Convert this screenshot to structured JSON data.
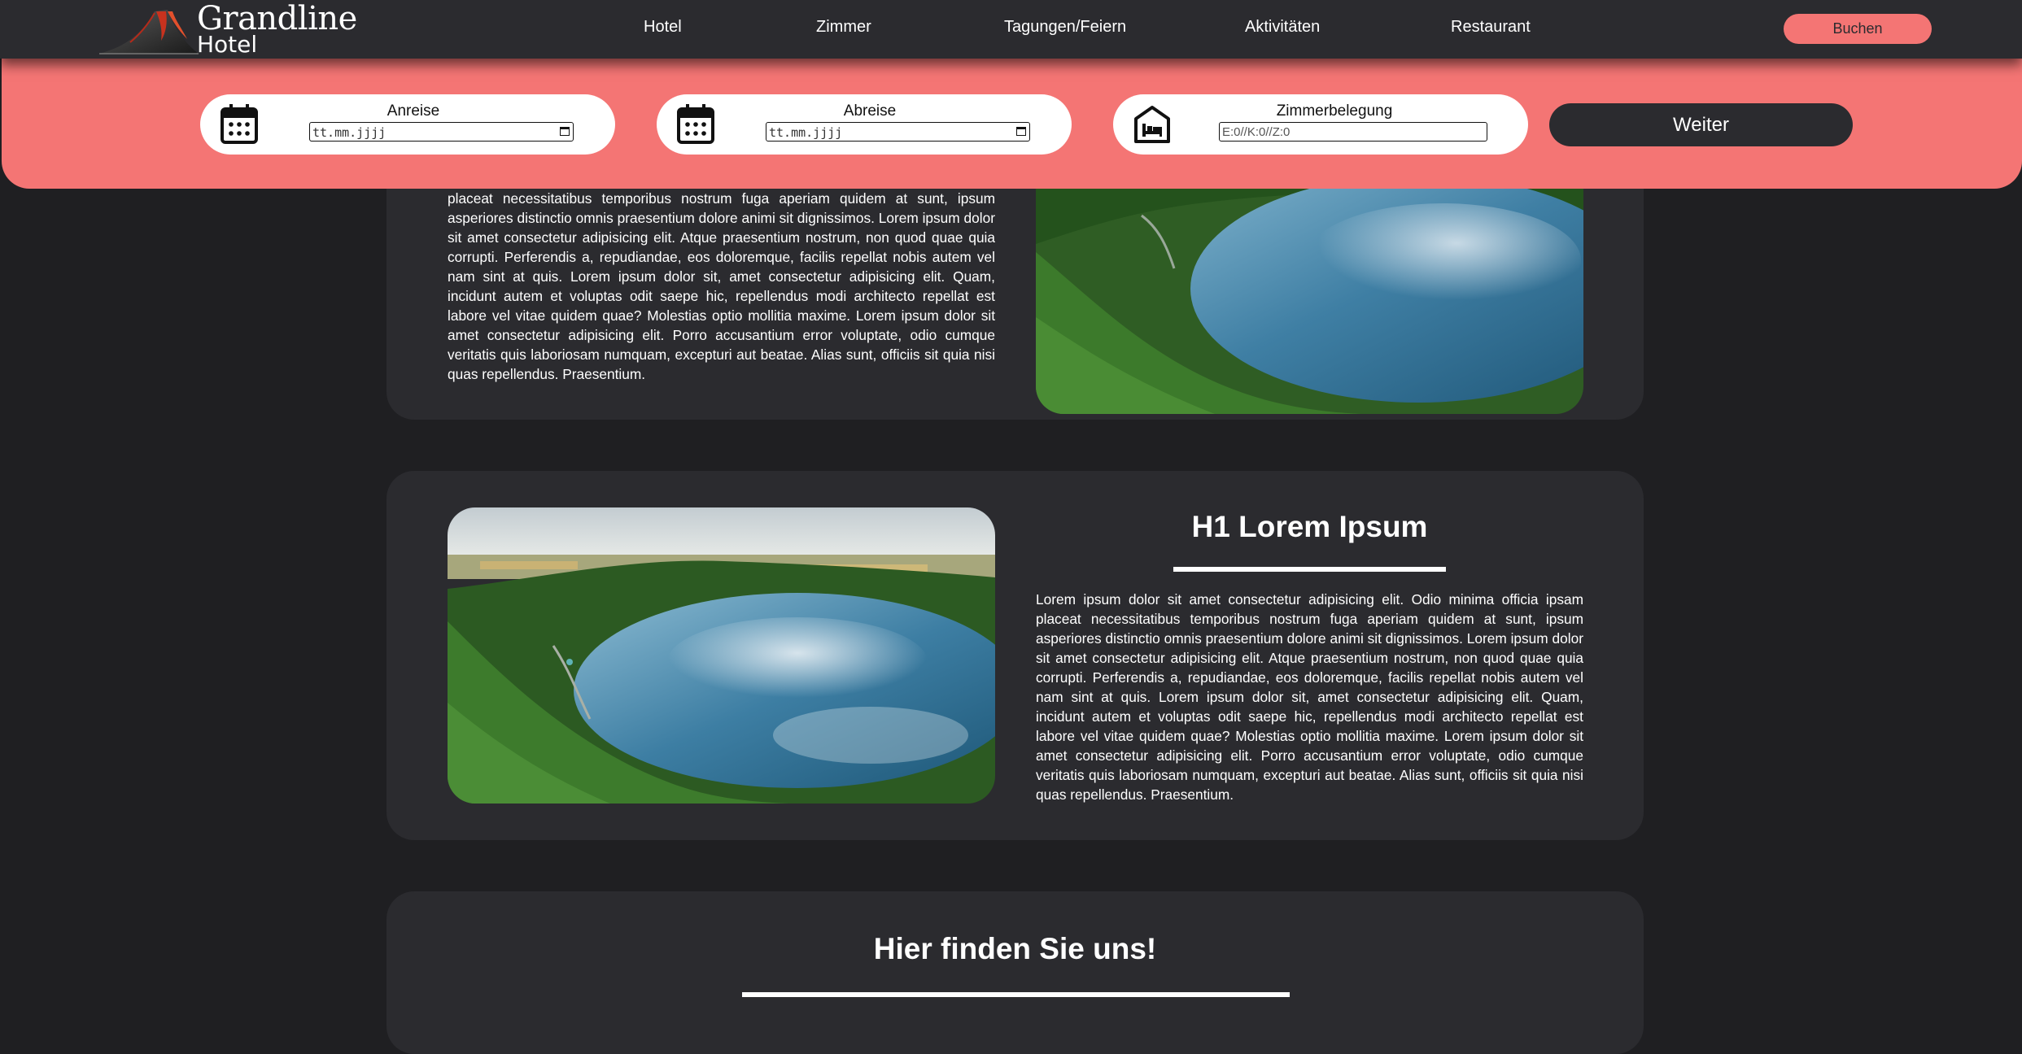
{
  "brand": {
    "name": "Grandline",
    "sub": "Hotel"
  },
  "nav": {
    "items": [
      {
        "label": "Hotel"
      },
      {
        "label": "Zimmer"
      },
      {
        "label": "Tagungen/Feiern"
      },
      {
        "label": "Aktivitäten"
      },
      {
        "label": "Restaurant"
      }
    ],
    "book_label": "Buchen"
  },
  "booking": {
    "arrival": {
      "label": "Anreise",
      "placeholder": "tt.mm.jjjj",
      "icon": "calendar-icon"
    },
    "departure": {
      "label": "Abreise",
      "placeholder": "tt.mm.jjjj",
      "icon": "calendar-icon"
    },
    "rooms": {
      "label": "Zimmerbelegung",
      "value": "E:0//K:0//Z:0",
      "icon": "bed-icon"
    },
    "next_label": "Weiter"
  },
  "sections": [
    {
      "text": "placeat necessitatibus temporibus nostrum fuga aperiam quidem at sunt, ipsum asperiores distinctio omnis praesentium dolore animi sit dignissimos. Lorem ipsum dolor sit amet consectetur adipisicing elit. Atque praesentium nostrum, non quod quae quia corrupti. Perferendis a, repudiandae, eos doloremque, facilis repellat nobis autem vel nam sint at quis. Lorem ipsum dolor sit, amet consectetur adipisicing elit. Quam, incidunt autem et voluptas odit saepe hic, repellendus modi architecto repellat est labore vel vitae quidem quae? Molestias optio mollitia maxime. Lorem ipsum dolor sit amet consectetur adipisicing elit. Porro accusantium error voluptate, odio cumque veritatis quis laboriosam numquam, excepturi aut beatae. Alias sunt, officiis sit quia nisi quas repellendus. Praesentium."
    },
    {
      "heading": "H1 Lorem Ipsum",
      "text": "Lorem ipsum dolor sit amet consectetur adipisicing elit. Odio minima officia ipsam placeat necessitatibus temporibus nostrum fuga aperiam quidem at sunt, ipsum asperiores distinctio omnis praesentium dolore animi sit dignissimos. Lorem ipsum dolor sit amet consectetur adipisicing elit. Atque praesentium nostrum, non quod quae quia corrupti. Perferendis a, repudiandae, eos doloremque, facilis repellat nobis autem vel nam sint at quis. Lorem ipsum dolor sit, amet consectetur adipisicing elit. Quam, incidunt autem et voluptas odit saepe hic, repellendus modi architecto repellat est labore vel vitae quidem quae? Molestias optio mollitia maxime. Lorem ipsum dolor sit amet consectetur adipisicing elit. Porro accusantium error voluptate, odio cumque veritatis quis laboriosam numquam, excepturi aut beatae. Alias sunt, officiis sit quia nisi quas repellendus. Praesentium."
    },
    {
      "heading": "Hier finden Sie uns!"
    }
  ],
  "colors": {
    "accent": "#f47574",
    "panel": "#2b2b2f",
    "background": "#1f1f22"
  }
}
